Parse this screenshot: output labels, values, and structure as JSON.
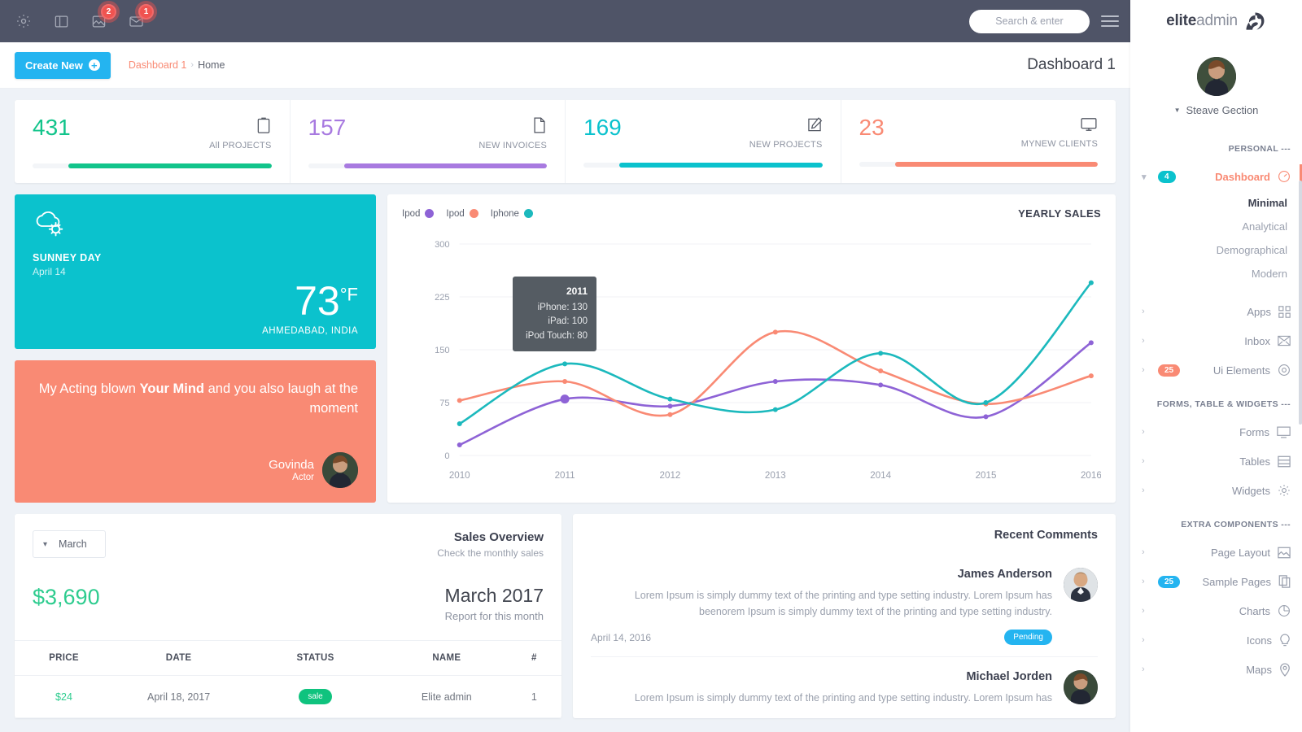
{
  "topbar": {
    "icons": [
      {
        "name": "gear-icon",
        "badge": null
      },
      {
        "name": "sidebar-toggle-icon",
        "badge": null
      },
      {
        "name": "image-notification-icon",
        "badge": "2"
      },
      {
        "name": "message-envelope-icon",
        "badge": "1"
      }
    ],
    "search_placeholder": "Search & enter",
    "search_value": ""
  },
  "page_header": {
    "create_button": "Create New",
    "breadcrumb_link": "Dashboard 1",
    "breadcrumb_sep": "›",
    "breadcrumb_current": "Home",
    "title": "Dashboard 1"
  },
  "stats": [
    {
      "value": "431",
      "label": "All PROJECTS",
      "color": "#12c48b",
      "icon": "clipboard-icon",
      "fill_pct": 85
    },
    {
      "value": "157",
      "label": "NEW INVOICES",
      "color": "#a munched",
      "icon": "file-icon",
      "fill_pct": 85
    },
    {
      "value": "169",
      "label": "NEW PROJECTS",
      "color": "#0bc2cd",
      "icon": "edit-square-icon",
      "fill_pct": 85
    },
    {
      "value": "23",
      "label": "MYNEW CLIENTS",
      "color": "#f98a74",
      "icon": "monitor-icon",
      "fill_pct": 85
    }
  ],
  "stat_colors": [
    "#12c48b",
    "#a87ae0",
    "#0bc2cd",
    "#f98a74"
  ],
  "weather": {
    "icon": "sun-cloud-icon",
    "condition": "SUNNEY DAY",
    "date": "April 14",
    "temperature": "73",
    "unit": "°F",
    "location": "AHMEDABAD, INDIA"
  },
  "actor": {
    "quote_part1": "My Acting blown ",
    "quote_bold": "Your Mind",
    "quote_part2": " and you also laugh at the moment",
    "name": "Govinda",
    "role": "Actor"
  },
  "chart_card": {
    "title": "YEARLY SALES",
    "tooltip": {
      "year": "2011",
      "rows": [
        "iPhone: 130",
        "iPad: 100",
        "iPod Touch: 80"
      ]
    }
  },
  "chart_data": {
    "type": "line",
    "title": "YEARLY SALES",
    "xlabel": "",
    "ylabel": "",
    "x": [
      "2010",
      "2011",
      "2012",
      "2013",
      "2014",
      "2015",
      "2016"
    ],
    "ylim": [
      0,
      300
    ],
    "yticks": [
      0,
      75,
      150,
      225,
      300
    ],
    "grid": true,
    "legend_position": "top-left",
    "legend": [
      "Ipod",
      "Ipod",
      "Iphone"
    ],
    "series": [
      {
        "name": "Ipod",
        "color": "#8e63d6",
        "values": [
          15,
          80,
          70,
          105,
          100,
          55,
          160
        ]
      },
      {
        "name": "Ipod",
        "color": "#f98a74",
        "values": [
          78,
          105,
          58,
          175,
          120,
          73,
          113
        ]
      },
      {
        "name": "Iphone",
        "color": "#1cb9bd",
        "values": [
          45,
          130,
          80,
          65,
          145,
          75,
          245
        ]
      }
    ]
  },
  "sales": {
    "month_select": "March",
    "title": "Sales Overview",
    "subtitle": "Check the monthly sales",
    "amount": "$3,690",
    "period": "March 2017",
    "report": "Report for this month",
    "columns": [
      "PRICE",
      "DATE",
      "STATUS",
      "NAME",
      "#"
    ],
    "rows": [
      {
        "price": "$24",
        "date": "April 18, 2017",
        "status": "sale",
        "name": "Elite admin",
        "num": "1"
      }
    ]
  },
  "comments": {
    "title": "Recent Comments",
    "items": [
      {
        "name": "James Anderson",
        "text": "Lorem Ipsum is simply dummy text of the printing and type setting industry. Lorem Ipsum has beenorem Ipsum is simply dummy text of the printing and type setting industry.",
        "date": "April 14, 2016",
        "badge": "Pending"
      },
      {
        "name": "Michael Jorden",
        "text": "Lorem Ipsum is simply dummy text of the printing and type setting industry. Lorem Ipsum has",
        "date": "",
        "badge": ""
      }
    ]
  },
  "sidebar": {
    "brand_bold": "elite",
    "brand_light": "admin",
    "profile_name": "Steave Gection",
    "sections": [
      {
        "label": "PERSONAL ---",
        "items": [
          {
            "label": "Dashboard",
            "icon": "gauge-icon",
            "arrow": "⌄",
            "badge": "4",
            "badge_color": "#0bc2cd",
            "active": true
          },
          {
            "label": "Apps",
            "icon": "grid-icon",
            "arrow": "›",
            "badge": null,
            "badge_color": null,
            "active": false
          },
          {
            "label": "Inbox",
            "icon": "envelope-icon",
            "arrow": "›",
            "badge": null,
            "badge_color": null,
            "active": false
          },
          {
            "label": "Ui Elements",
            "icon": "ui-elements-icon",
            "arrow": "›",
            "badge": "25",
            "badge_color": "#f98a74",
            "active": false
          }
        ],
        "subitems": [
          "Minimal",
          "Analytical",
          "Demographical",
          "Modern"
        ],
        "current_sub": "Minimal"
      },
      {
        "label": "FORMS, TABLE & WIDGETS ---",
        "items": [
          {
            "label": "Forms",
            "icon": "monitor-icon",
            "arrow": "›",
            "badge": null,
            "badge_color": null,
            "active": false
          },
          {
            "label": "Tables",
            "icon": "table-icon",
            "arrow": "›",
            "badge": null,
            "badge_color": null,
            "active": false
          },
          {
            "label": "Widgets",
            "icon": "gear-icon",
            "arrow": "›",
            "badge": null,
            "badge_color": null,
            "active": false
          }
        ],
        "subitems": [],
        "current_sub": ""
      },
      {
        "label": "EXTRA COMPONENTS ---",
        "items": [
          {
            "label": "Page Layout",
            "icon": "layout-image-icon",
            "arrow": "›",
            "badge": null,
            "badge_color": null,
            "active": false
          },
          {
            "label": "Sample Pages",
            "icon": "copy-icon",
            "arrow": "›",
            "badge": "25",
            "badge_color": "#24b4f0",
            "active": false
          },
          {
            "label": "Charts",
            "icon": "pie-chart-icon",
            "arrow": "›",
            "badge": null,
            "badge_color": null,
            "active": false
          },
          {
            "label": "Icons",
            "icon": "lightbulb-icon",
            "arrow": "›",
            "badge": null,
            "badge_color": null,
            "active": false
          },
          {
            "label": "Maps",
            "icon": "map-pin-icon",
            "arrow": "›",
            "badge": null,
            "badge_color": null,
            "active": false
          }
        ],
        "subitems": [],
        "current_sub": ""
      }
    ]
  }
}
